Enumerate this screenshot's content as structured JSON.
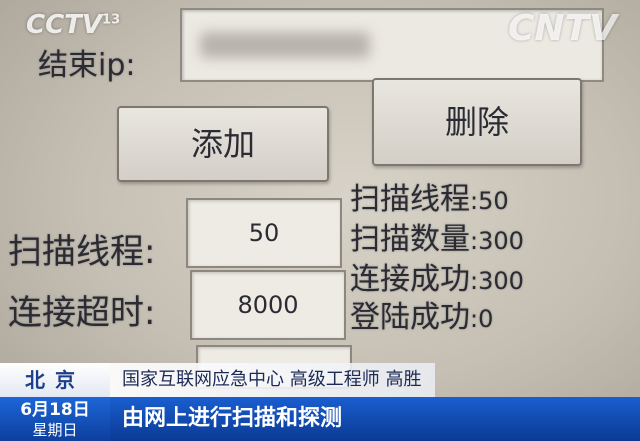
{
  "form": {
    "end_ip_label": "结束ip:",
    "add_button": "添加",
    "delete_button": "删除",
    "threads_label": "扫描线程:",
    "threads_value": "50",
    "timeout_label": "连接超时:",
    "timeout_value": "8000"
  },
  "stats": [
    {
      "label": "扫描线程",
      "value": ":50"
    },
    {
      "label": "扫描数量",
      "value": ":300"
    },
    {
      "label": "连接成功",
      "value": ":300"
    },
    {
      "label": "登陆成功",
      "value": ":0"
    }
  ],
  "broadcast": {
    "channel_logo": "CCTV",
    "channel_number": "13",
    "corner_logo": "CNTV",
    "location": "北京",
    "speaker": "国家互联网应急中心 高级工程师 高胜",
    "date": "6月18日",
    "weekday": "星期日",
    "caption": "由网上进行扫描和探测"
  },
  "colors": {
    "banner_blue": "#0d3f9e",
    "location_text": "#1a3e8a"
  }
}
